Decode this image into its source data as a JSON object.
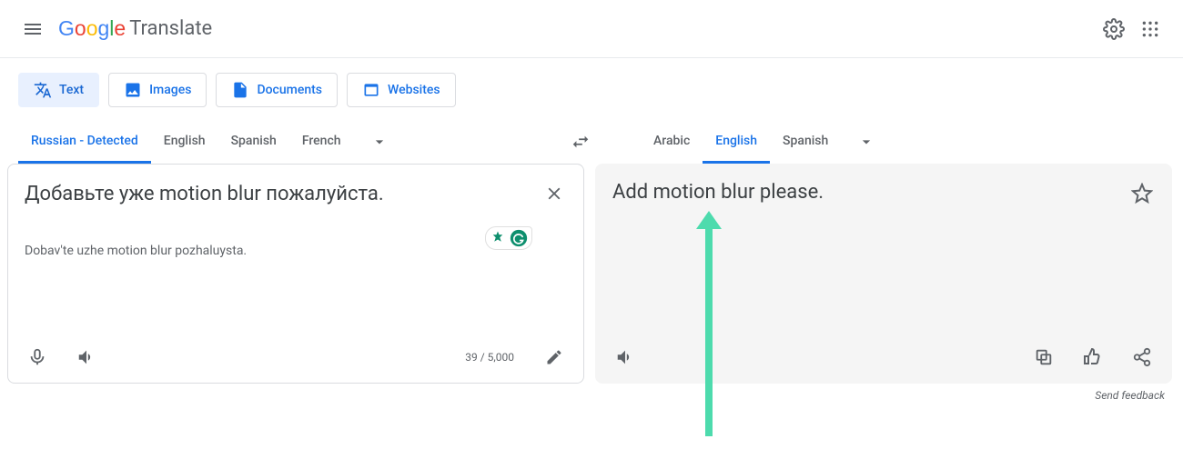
{
  "app": {
    "brand": "Google",
    "product": "Translate"
  },
  "modes": {
    "text": {
      "label": "Text"
    },
    "images": {
      "label": "Images"
    },
    "docs": {
      "label": "Documents"
    },
    "web": {
      "label": "Websites"
    }
  },
  "source_langs": {
    "detected": "Russian - Detected",
    "l1": "English",
    "l2": "Spanish",
    "l3": "French"
  },
  "target_langs": {
    "l1": "Arabic",
    "l2": "English",
    "l3": "Spanish"
  },
  "source": {
    "text": "Добавьте уже motion blur пожалуйста.",
    "translit": "Dobav'te uzhe motion blur pozhaluysta.",
    "char_count": "39 / 5,000"
  },
  "target": {
    "text": "Add motion blur please."
  },
  "footer": {
    "feedback": "Send feedback"
  }
}
